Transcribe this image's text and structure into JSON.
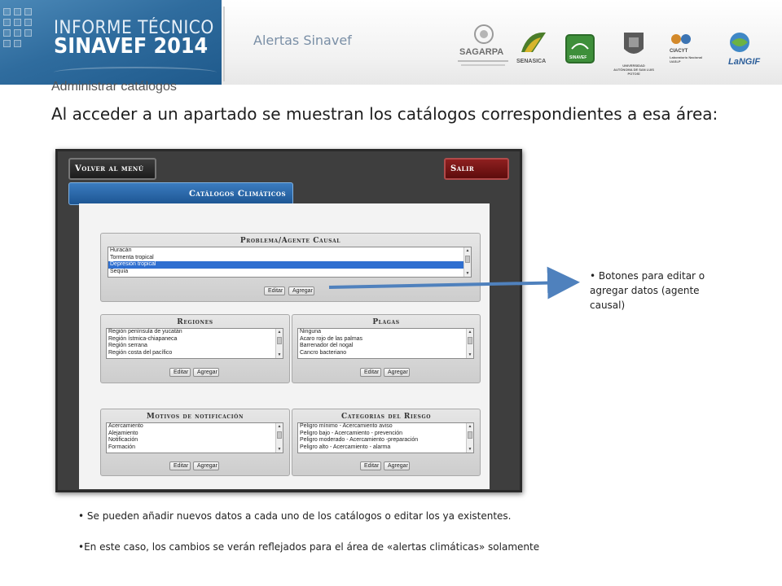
{
  "banner": {
    "line1": "INFORME TÉCNICO",
    "line2": "SINAVEF 2014",
    "section": "Alertas Sinavef"
  },
  "logos": {
    "sagarpa": "SAGARPA",
    "senasica": "SENASICA",
    "sinavef": "SINAVEF",
    "uaslp": "UNIVERSIDAD AUTÓNOMA DE SAN LUIS POTOSÍ",
    "ciacyt": "CIACYT",
    "ciacyt_sub": "Laboratorio Nacional UASLP",
    "langif": "LaNGIF"
  },
  "heading": "Administrar catálogos",
  "title": "Al acceder a un apartado se muestran los catálogos correspondientes a esa área:",
  "app": {
    "btn_back": "Volver al menú",
    "btn_exit": "Salir",
    "tab": "Catálogos Climáticos",
    "edit_label": "Editar",
    "add_label": "Agregar",
    "panels": [
      {
        "id": "problema",
        "title": "Problema/Agente Causal",
        "items": [
          "Huracán",
          "Tormenta tropical",
          "Depresión tropical",
          "Sequía"
        ],
        "selected": 2
      },
      {
        "id": "regiones",
        "title": "Regiones",
        "items": [
          "Región península de yucatán",
          "Región ístmica-chiapaneca",
          "Región serrana",
          "Región costa del pacífico"
        ],
        "selected": -1
      },
      {
        "id": "plagas",
        "title": "Plagas",
        "items": [
          "Ninguna",
          "Acaro rojo de las palmas",
          "Barrenador del nogal",
          "Cancro bacteriano"
        ],
        "selected": -1
      },
      {
        "id": "motivos",
        "title": "Motivos de notificación",
        "items": [
          "Acercamiento",
          "Alejamiento",
          "Notificación",
          "Formación"
        ],
        "selected": -1
      },
      {
        "id": "categorias",
        "title": "Categorias del Riesgo",
        "items": [
          "Peligro mínimo - Acercamiento aviso",
          "Peligro bajo - Acercamiento - prevención",
          "Peligro moderado - Acercamiento -preparación",
          "Peligro alto - Acercamiento - alarma"
        ],
        "selected": -1
      }
    ]
  },
  "annotations": {
    "side_note": "Botones para editar o agregar datos (agente causal)",
    "bullet1": "Se pueden añadir nuevos datos a cada uno de los catálogos o editar los ya existentes.",
    "bullet2": "En este caso, los cambios se verán reflejados para el área de «alertas climáticas» solamente",
    "bullet_char": "•"
  },
  "colors": {
    "banner_blue": "#2f6c9e",
    "arrow_blue": "#4f81bd",
    "selected_row": "#2f6fd0",
    "exit_red": "#7a1414",
    "tab_blue": "#2a68a8"
  }
}
